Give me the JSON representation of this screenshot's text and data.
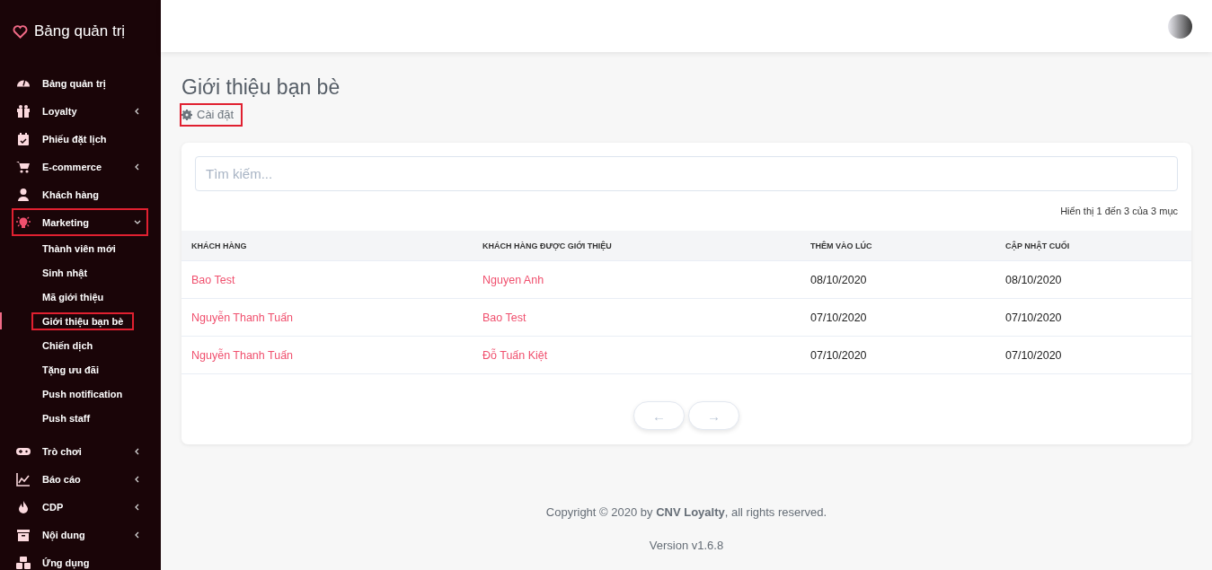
{
  "brand": {
    "title": "Bảng quản trị"
  },
  "sidebar": {
    "items": [
      {
        "label": "Bảng quản trị",
        "has_submenu": false,
        "selected": false,
        "highlighted": false
      },
      {
        "label": "Loyalty",
        "has_submenu": true,
        "expanded": false,
        "selected": false,
        "highlighted": false
      },
      {
        "label": "Phiếu đặt lịch",
        "has_submenu": false,
        "selected": false,
        "highlighted": false
      },
      {
        "label": "E-commerce",
        "has_submenu": true,
        "expanded": false,
        "selected": false,
        "highlighted": false
      },
      {
        "label": "Khách hàng",
        "has_submenu": false,
        "selected": false,
        "highlighted": false
      },
      {
        "label": "Marketing",
        "has_submenu": true,
        "expanded": true,
        "selected": true,
        "highlighted": true,
        "children": [
          {
            "label": "Thành viên mới",
            "selected": false,
            "highlighted": false
          },
          {
            "label": "Sinh nhật",
            "selected": false,
            "highlighted": false
          },
          {
            "label": "Mã giới thiệu",
            "selected": false,
            "highlighted": false
          },
          {
            "label": "Giới thiệu bạn bè",
            "selected": true,
            "highlighted": true
          },
          {
            "label": "Chiến dịch",
            "selected": false,
            "highlighted": false
          },
          {
            "label": "Tặng ưu đãi",
            "selected": false,
            "highlighted": false
          },
          {
            "label": "Push notification",
            "selected": false,
            "highlighted": false
          },
          {
            "label": "Push staff",
            "selected": false,
            "highlighted": false
          }
        ]
      },
      {
        "label": "Trò chơi",
        "has_submenu": true,
        "expanded": false,
        "selected": false,
        "highlighted": false
      },
      {
        "label": "Báo cáo",
        "has_submenu": true,
        "expanded": false,
        "selected": false,
        "highlighted": false
      },
      {
        "label": "CDP",
        "has_submenu": true,
        "expanded": false,
        "selected": false,
        "highlighted": false
      },
      {
        "label": "Nội dung",
        "has_submenu": true,
        "expanded": false,
        "selected": false,
        "highlighted": false
      },
      {
        "label": "Ứng dụng",
        "has_submenu": false,
        "selected": false,
        "highlighted": false
      }
    ]
  },
  "page": {
    "title": "Giới thiệu bạn bè",
    "settings_link": {
      "label": "Cài đặt",
      "highlighted": true
    }
  },
  "search": {
    "placeholder": "Tìm kiếm..."
  },
  "table_info": "Hiển thị 1 đến 3 của 3 mục",
  "table": {
    "columns": [
      "KHÁCH HÀNG",
      "KHÁCH HÀNG ĐƯỢC GIỚI THIỆU",
      "THÊM VÀO LÚC",
      "CẬP NHẬT CUỐI"
    ],
    "rows": [
      [
        "Bao Test",
        "Nguyen Anh",
        "08/10/2020",
        "08/10/2020"
      ],
      [
        "Nguyễn Thanh Tuấn",
        "Bao Test",
        "07/10/2020",
        "07/10/2020"
      ],
      [
        "Nguyễn Thanh Tuấn",
        "Đỗ Tuấn Kiệt",
        "07/10/2020",
        "07/10/2020"
      ]
    ]
  },
  "pagination": {
    "prev": "←",
    "next": "→"
  },
  "footer": {
    "copyright": "Copyright © 2020 by **CNV Loyalty**, all rights reserved.",
    "version": "Version v1.6.8"
  }
}
